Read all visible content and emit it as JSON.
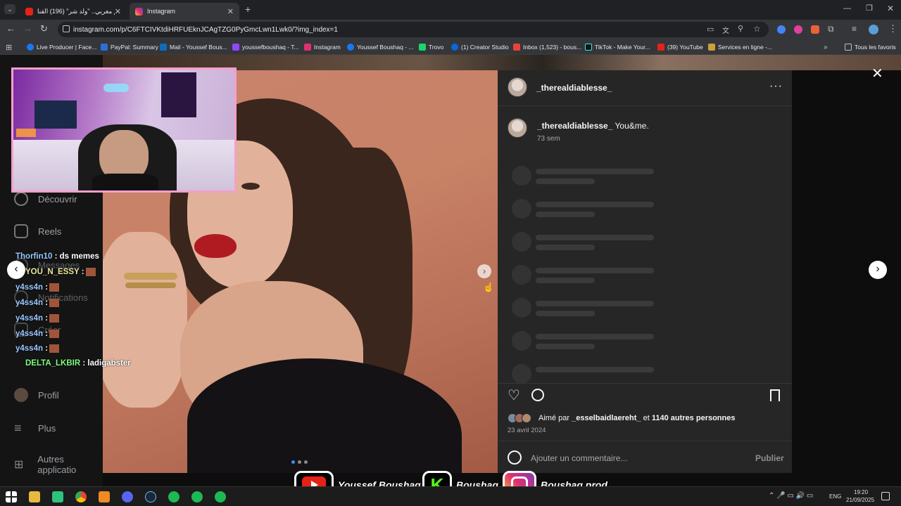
{
  "browser": {
    "tabs": [
      {
        "title": "فيلم مغربي.. \"ولد شر\" (196) القنا",
        "active": false
      },
      {
        "title": "Instagram",
        "active": true
      }
    ],
    "new_tab": "+",
    "url": "instagram.com/p/C6FTCIVKtdiHRFUEknJCAgTZG0PyGmcLwn1Lwk0/?img_index=1",
    "bookmarks": [
      "Live Producer | Face...",
      "PayPal: Summary",
      "Mail - Youssef Bous...",
      "youssefboushaq - T...",
      "Instagram",
      "Youssef Boushaq - ...",
      "Trovo",
      "(1) Creator Studio",
      "Inbox (1,523) - bous...",
      "TikTok - Make Your...",
      "(39) YouTube",
      "Services en ligne -..."
    ],
    "all_favorites": "Tous les favoris"
  },
  "nav": {
    "items": [
      "Découvrir",
      "Reels",
      "Messages",
      "Notifications",
      "Créer",
      "Profil",
      "Plus",
      "Autres applicatio"
    ]
  },
  "post": {
    "username": "_therealdiablesse_",
    "caption": "You&me.",
    "age": "73 sem",
    "liked_by_prefix": "Aimé par",
    "liked_by_user": "_esselbaidlaereht_",
    "and": "et",
    "others": "1140 autres personnes",
    "date": "23 avril 2024",
    "comment_placeholder": "Ajouter un commentaire...",
    "publish": "Publier"
  },
  "chat": [
    {
      "user": "Thorfin10",
      "msg": ": ds memes"
    },
    {
      "user": "YOU_N_ESSY",
      "msg": ":"
    },
    {
      "user": "y4ss4n",
      "msg": ":"
    },
    {
      "user": "y4ss4n",
      "msg": ":"
    },
    {
      "user": "y4ss4n",
      "msg": ":"
    },
    {
      "user": "y4ss4n",
      "msg": ":"
    },
    {
      "user": "y4ss4n",
      "msg": ":"
    },
    {
      "user": "DELTA_LKBIR",
      "msg": ": ladigabster"
    }
  ],
  "social": {
    "youtube": "Youssef Boushaq",
    "kick": "Boushaq",
    "instagram": "Boushaq.prod"
  },
  "taskbar": {
    "lang": "ENG",
    "time": "19:20",
    "date": "21/09/2025"
  },
  "colors": {
    "accent_pink": "#f4a0c8",
    "instagram_panel": "#262626"
  }
}
